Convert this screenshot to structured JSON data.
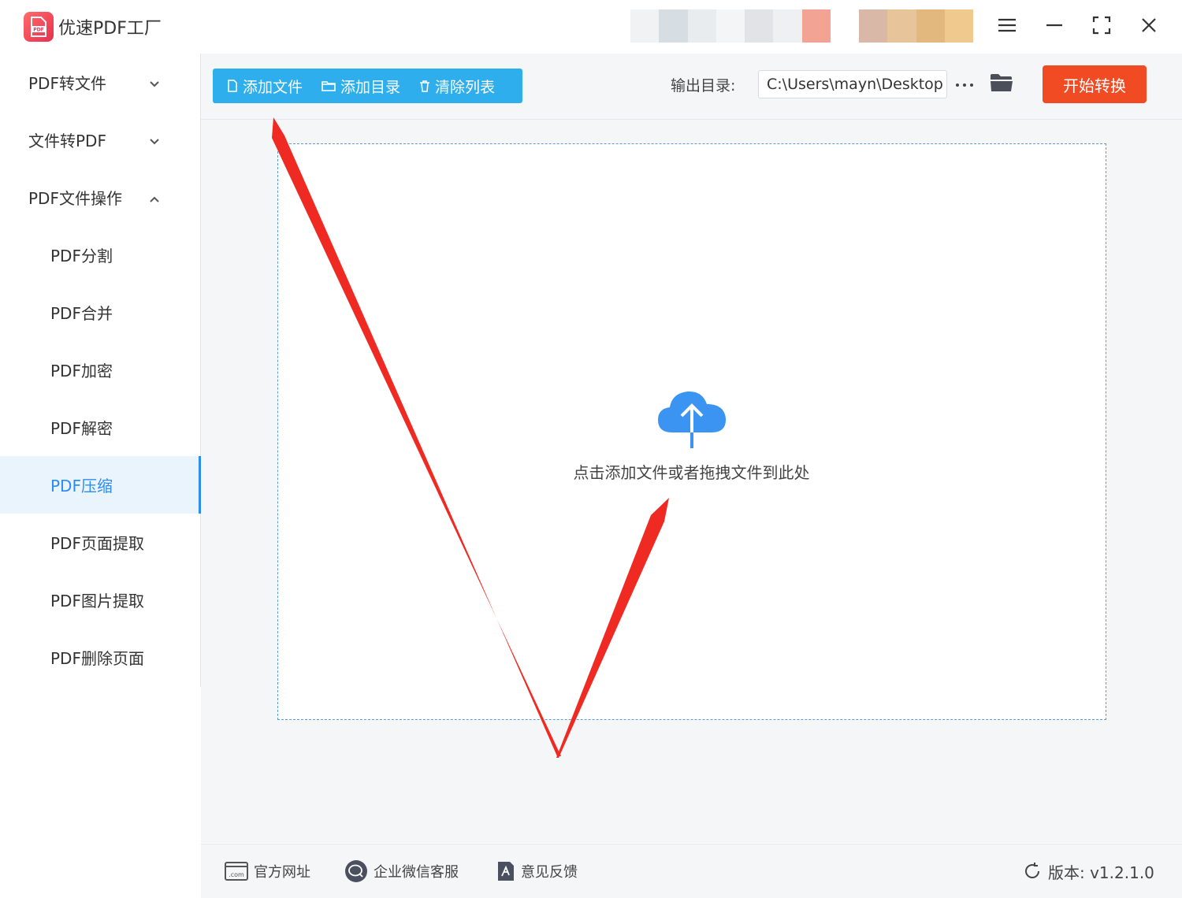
{
  "app": {
    "title": "优速PDF工厂",
    "logo_icon": "pdf-file-icon",
    "accent_color": "#2eaeed",
    "start_color": "#f04b23"
  },
  "sidebar": {
    "groups": [
      {
        "label": "PDF转文件",
        "expanded": false
      },
      {
        "label": "文件转PDF",
        "expanded": false
      },
      {
        "label": "PDF文件操作",
        "expanded": true
      }
    ],
    "items": [
      {
        "label": "PDF分割"
      },
      {
        "label": "PDF合并"
      },
      {
        "label": "PDF加密"
      },
      {
        "label": "PDF解密"
      },
      {
        "label": "PDF压缩",
        "active": true
      },
      {
        "label": "PDF页面提取"
      },
      {
        "label": "PDF图片提取"
      },
      {
        "label": "PDF删除页面"
      }
    ]
  },
  "toolbar": {
    "add_file": "添加文件",
    "add_folder": "添加目录",
    "clear_list": "清除列表",
    "output_label": "输出目录:",
    "output_path": "C:\\Users\\mayn\\Desktop",
    "start": "开始转换"
  },
  "dropzone": {
    "text": "点击添加文件或者拖拽文件到此处",
    "icon": "cloud-upload-icon"
  },
  "footer": {
    "website": "官方网址",
    "wechat": "企业微信客服",
    "feedback": "意见反馈",
    "version": "版本: v1.2.1.0"
  }
}
